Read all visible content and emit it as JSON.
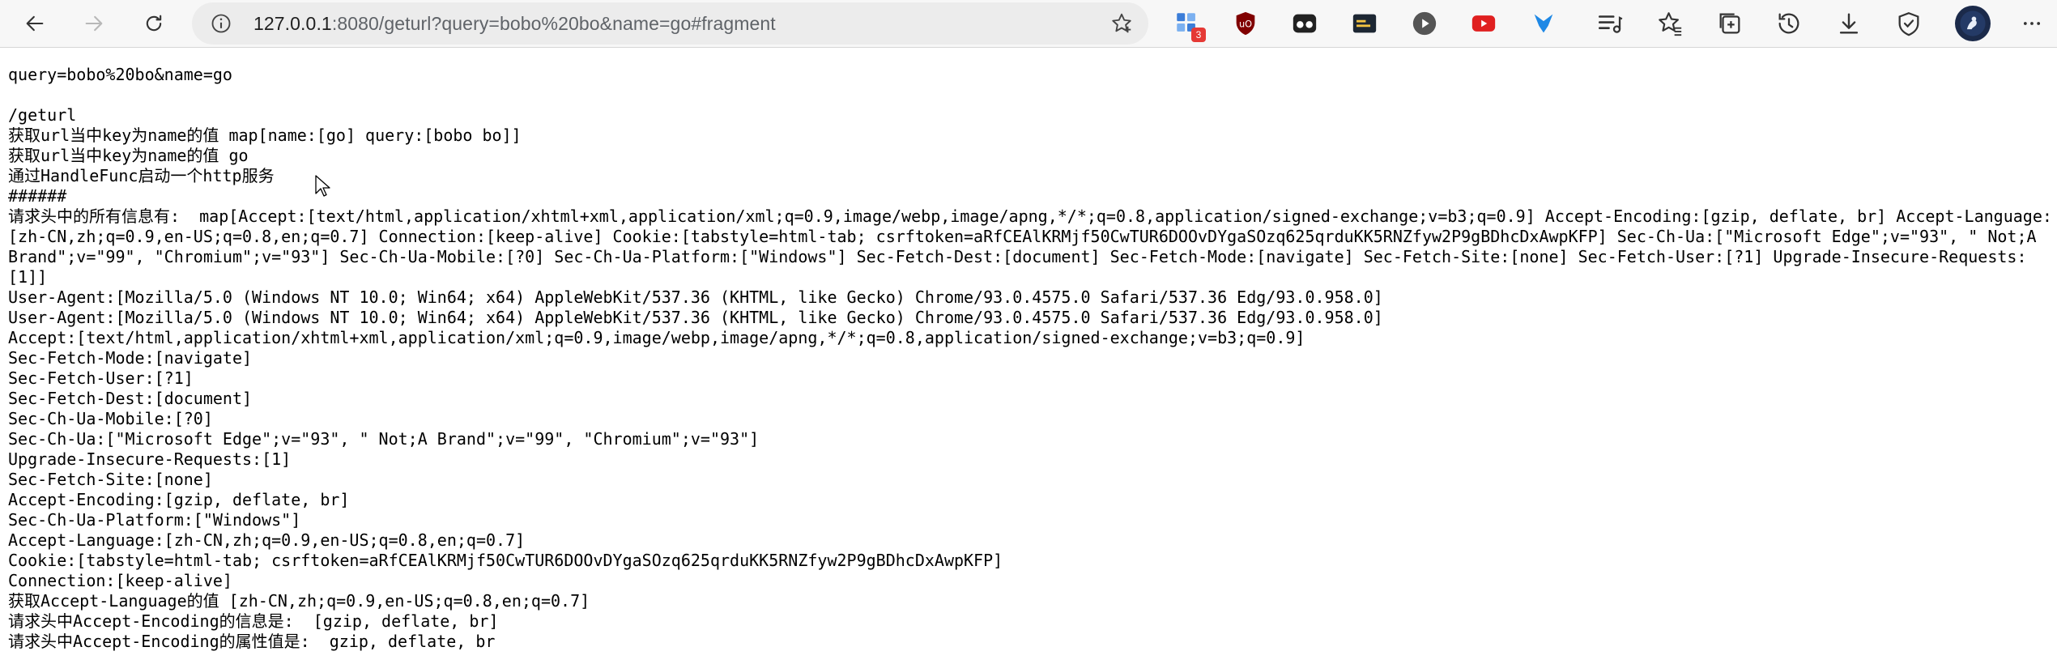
{
  "browser": {
    "address_host": "127.0.0.1",
    "address_rest": ":8080/geturl?query=bobo%20bo&name=go#fragment",
    "extension_badge_count": "3",
    "icons": [
      "back-icon",
      "forward-icon",
      "refresh-icon",
      "info-icon",
      "favorite-add-icon",
      "extensions-icon",
      "ublock-icon",
      "tampermonkey-icon",
      "terminal-icon",
      "play-icon",
      "youtube-icon",
      "bird-icon",
      "reading-list-icon",
      "favorites-icon",
      "collections-icon",
      "history-icon",
      "downloads-icon",
      "browser-essentials-icon",
      "profile-avatar",
      "more-icon"
    ]
  },
  "content": {
    "query_line": "query=bobo%20bo&name=go",
    "path_line": "/geturl",
    "map_line": "获取url当中key为name的值 map[name:[go] query:[bobo bo]]",
    "name_line": "获取url当中key为name的值 go",
    "handlefunc_line": "通过HandleFunc启动一个http服务",
    "separator": "######",
    "all_headers": "请求头中的所有信息有:  map[Accept:[text/html,application/xhtml+xml,application/xml;q=0.9,image/webp,image/apng,*/*;q=0.8,application/signed-exchange;v=b3;q=0.9] Accept-Encoding:[gzip, deflate, br] Accept-Language:[zh-CN,zh;q=0.9,en-US;q=0.8,en;q=0.7] Connection:[keep-alive] Cookie:[tabstyle=html-tab; csrftoken=aRfCEAlKRMjf50CwTUR6DOOvDYgaSOzq625qrduKK5RNZfyw2P9gBDhcDxAwpKFP] Sec-Ch-Ua:[\"Microsoft Edge\";v=\"93\", \" Not;A Brand\";v=\"99\", \"Chromium\";v=\"93\"] Sec-Ch-Ua-Mobile:[?0] Sec-Ch-Ua-Platform:[\"Windows\"] Sec-Fetch-Dest:[document] Sec-Fetch-Mode:[navigate] Sec-Fetch-Site:[none] Sec-Fetch-User:[?1] Upgrade-Insecure-Requests:[1]]",
    "header_lines": [
      "User-Agent:[Mozilla/5.0 (Windows NT 10.0; Win64; x64) AppleWebKit/537.36 (KHTML, like Gecko) Chrome/93.0.4575.0 Safari/537.36 Edg/93.0.958.0]",
      "Accept:[text/html,application/xhtml+xml,application/xml;q=0.9,image/webp,image/apng,*/*;q=0.8,application/signed-exchange;v=b3;q=0.9]",
      "Sec-Fetch-Mode:[navigate]",
      "Sec-Fetch-User:[?1]",
      "Sec-Fetch-Dest:[document]",
      "Sec-Ch-Ua-Mobile:[?0]",
      "Sec-Ch-Ua:[\"Microsoft Edge\";v=\"93\", \" Not;A Brand\";v=\"99\", \"Chromium\";v=\"93\"]",
      "Upgrade-Insecure-Requests:[1]",
      "Sec-Fetch-Site:[none]",
      "Accept-Encoding:[gzip, deflate, br]",
      "Sec-Ch-Ua-Platform:[\"Windows\"]",
      "Accept-Language:[zh-CN,zh;q=0.9,en-US;q=0.8,en;q=0.7]",
      "Cookie:[tabstyle=html-tab; csrftoken=aRfCEAlKRMjf50CwTUR6DOOvDYgaSOzq625qrduKK5RNZfyw2P9gBDhcDxAwpKFP]",
      "Connection:[keep-alive]"
    ],
    "accept_language_line": "获取Accept-Language的值 [zh-CN,zh;q=0.9,en-US;q=0.8,en;q=0.7]",
    "encoding_info_line": "请求头中Accept-Encoding的信息是:  [gzip, deflate, br]",
    "encoding_value_line": "请求头中Accept-Encoding的属性值是:  gzip, deflate, br"
  }
}
